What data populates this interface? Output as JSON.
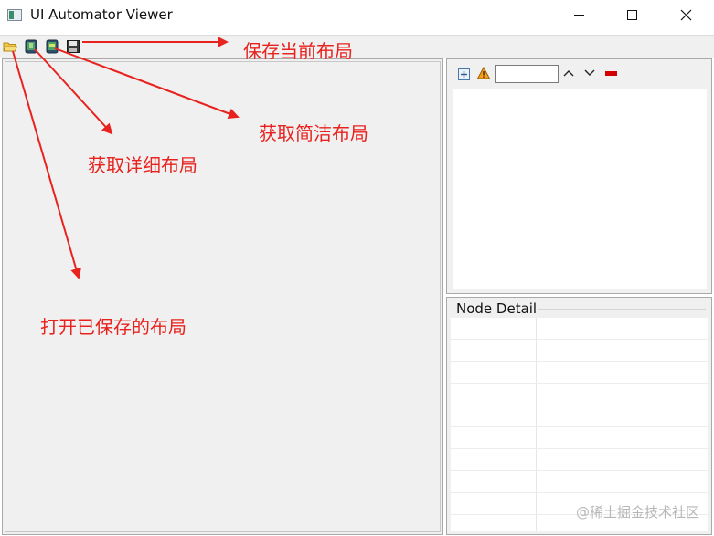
{
  "window": {
    "title": "UI Automator Viewer",
    "minimize_glyph": "minimize-icon",
    "maximize_glyph": "maximize-icon",
    "close_glyph": "close-icon"
  },
  "toolbar": {
    "icons": [
      "open-folder-icon",
      "device-screenshot-icon",
      "device-screenshot-compressed-icon",
      "save-icon"
    ]
  },
  "tree_panel": {
    "filter_value": "",
    "icons": [
      "expand-all-icon",
      "warning-icon",
      "chevron-up-icon",
      "chevron-down-icon",
      "clear-icon"
    ]
  },
  "detail_panel": {
    "title": "Node Detail"
  },
  "annotations": {
    "save_current": "保存当前布局",
    "get_compressed": "获取简洁布局",
    "get_detailed": "获取详细布局",
    "open_saved": "打开已保存的布局",
    "color": "#e8231f"
  },
  "watermark": "@稀土掘金技术社区"
}
